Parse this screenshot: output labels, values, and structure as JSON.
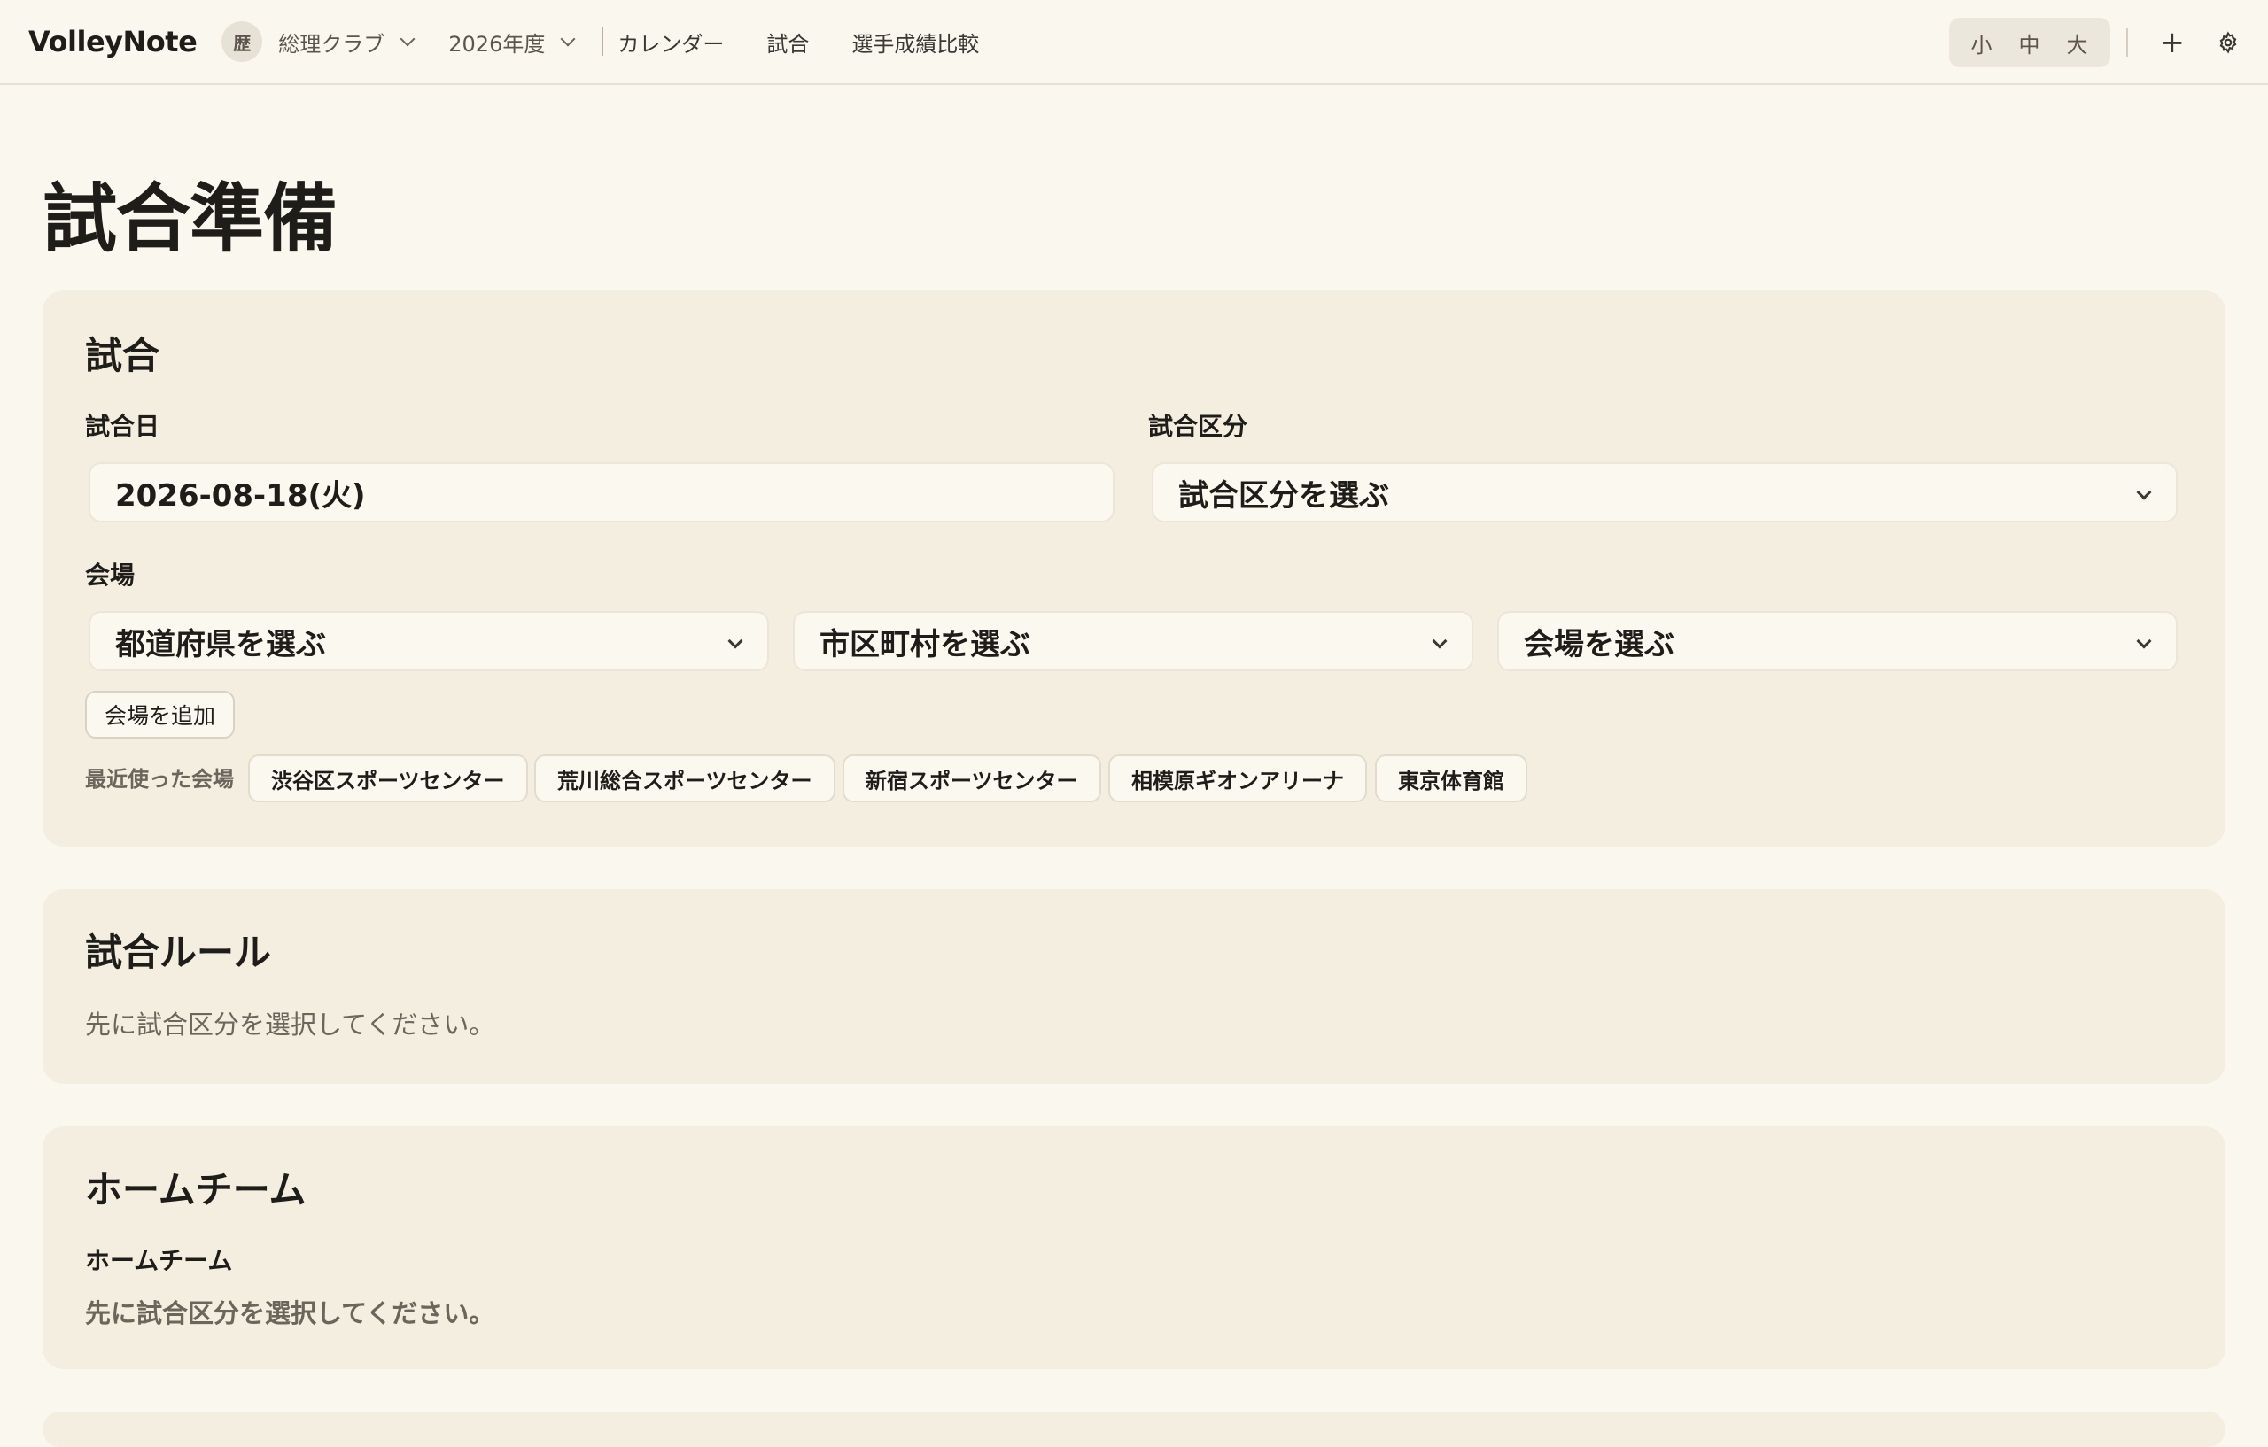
{
  "app": {
    "brand": "VolleyNote"
  },
  "nav": {
    "club_avatar": "歴",
    "club_name": "総理クラブ",
    "year": "2026年度",
    "links": [
      "カレンダー",
      "試合",
      "選手成績比較"
    ]
  },
  "font_size_toggle": [
    "小",
    "中",
    "大"
  ],
  "icons": {
    "add": "plus-icon",
    "settings": "gear-icon"
  },
  "page": {
    "title": "試合準備"
  },
  "match_card": {
    "title": "試合",
    "date_label": "試合日",
    "date_value": "2026-08-18(火)",
    "type_label": "試合区分",
    "type_placeholder": "試合区分を選ぶ",
    "venue_label": "会場",
    "prefecture_placeholder": "都道府県を選ぶ",
    "city_placeholder": "市区町村を選ぶ",
    "venue_placeholder": "会場を選ぶ",
    "add_venue_button": "会場を追加",
    "recent_label": "最近使った会場",
    "recent_venues": [
      "渋谷区スポーツセンター",
      "荒川総合スポーツセンター",
      "新宿スポーツセンター",
      "相模原ギオンアリーナ",
      "東京体育館"
    ]
  },
  "rules_card": {
    "title": "試合ルール",
    "hint": "先に試合区分を選択してください。"
  },
  "home_card": {
    "title": "ホームチーム",
    "label": "ホームチーム",
    "hint": "先に試合区分を選択してください。"
  }
}
